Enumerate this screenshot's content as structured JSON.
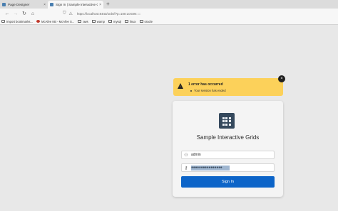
{
  "browser": {
    "tabs": [
      {
        "label": "Page Designer",
        "close": "×"
      },
      {
        "label": "Sign In | Sample Interactive Grids",
        "close": "×"
      }
    ],
    "new_tab": "+",
    "url": "https://localhost:8443/ords/f?p=100:LOGIN:::::",
    "nav": {
      "back": "←",
      "forward": "→",
      "reload": "↻",
      "home": "⌂"
    },
    "bookmarks": [
      {
        "label": "Import bookmarks...",
        "icon": "folder"
      },
      {
        "label": "McAfee KB - McAfee S...",
        "icon": "mcafee"
      },
      {
        "label": "aws",
        "icon": "folder"
      },
      {
        "label": "wamp",
        "icon": "folder"
      },
      {
        "label": "mysql",
        "icon": "folder"
      },
      {
        "label": "linux",
        "icon": "folder"
      },
      {
        "label": "oracle",
        "icon": "folder"
      }
    ]
  },
  "alert": {
    "title": "1 error has occurred",
    "message": "Your session has ended",
    "close": "×",
    "color": "#fcd15a"
  },
  "login": {
    "app_title": "Sample Interactive Grids",
    "username": "admin",
    "password_mask": "●●●●●●●●●●●●●●●●",
    "signin_label": "Sign In",
    "button_color": "#0c64c8"
  }
}
